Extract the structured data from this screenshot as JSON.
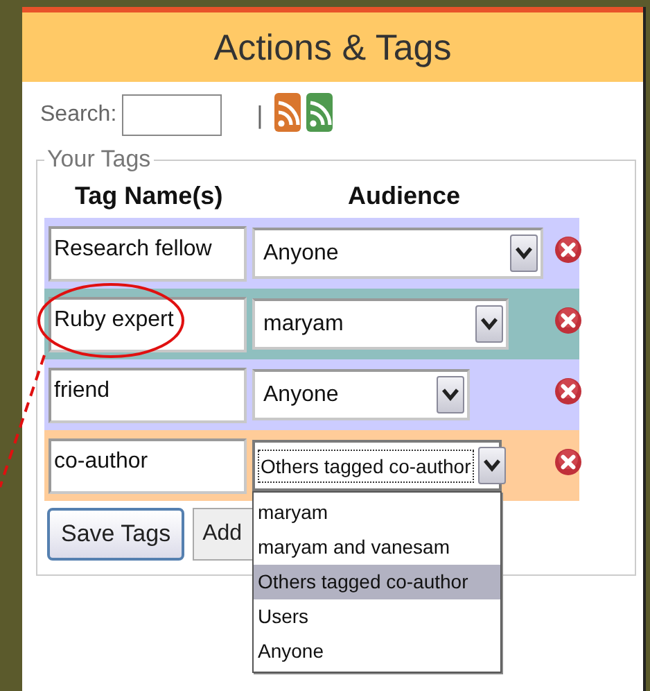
{
  "header": {
    "title": "Actions & Tags"
  },
  "search": {
    "label": "Search:",
    "separator": "|"
  },
  "feeds": [
    {
      "color": "#d9762e"
    },
    {
      "color": "#4f9a4f"
    }
  ],
  "tags": {
    "legend": "Your Tags",
    "columns": [
      "Tag Name(s)",
      "Audience"
    ],
    "rows": [
      {
        "tag": "Research fellow",
        "audience": "Anyone",
        "color": "#ccccff",
        "annotated": false,
        "open": false
      },
      {
        "tag": "Ruby expert",
        "audience": "maryam",
        "color": "#8fbfbf",
        "annotated": true,
        "open": false
      },
      {
        "tag": "friend",
        "audience": "Anyone",
        "color": "#ccccff",
        "annotated": false,
        "open": false
      },
      {
        "tag": "co-author",
        "audience": "Others tagged co-author",
        "color": "#ffcc99",
        "annotated": false,
        "open": true,
        "options": [
          {
            "label": "maryam",
            "selected": false
          },
          {
            "label": "maryam and vanesam",
            "selected": false
          },
          {
            "label": "Others tagged co-author",
            "selected": true
          },
          {
            "label": "Users",
            "selected": false
          },
          {
            "label": "Anyone",
            "selected": false
          }
        ]
      }
    ]
  },
  "buttons": [
    "Save Tags",
    "Add"
  ]
}
